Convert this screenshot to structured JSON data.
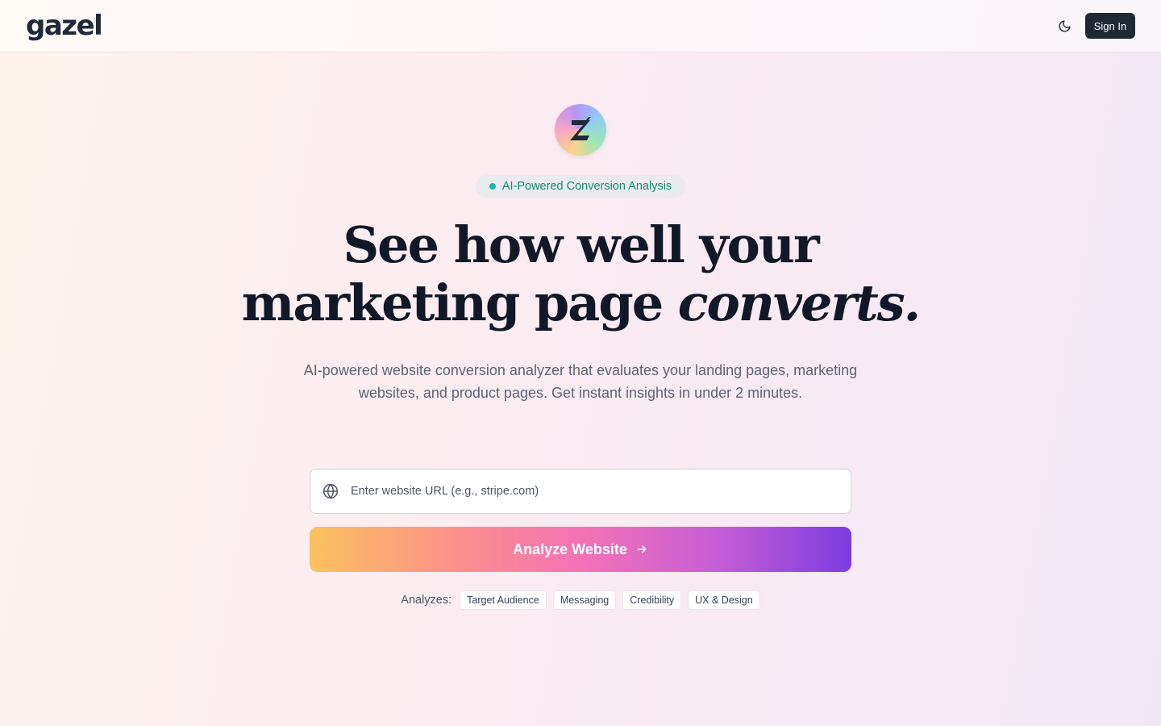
{
  "header": {
    "logo": "gazel",
    "sign_in_label": "Sign In"
  },
  "hero": {
    "badge_text": "AI-Powered Conversion Analysis",
    "headline_line1": "See how well your",
    "headline_line2_plain": "marketing page ",
    "headline_line2_italic": "converts.",
    "subtitle": "AI-powered website conversion analyzer that evaluates your landing pages, marketing websites, and product pages. Get instant insights in under 2 minutes."
  },
  "search": {
    "placeholder": "Enter website URL (e.g., stripe.com)",
    "value": ""
  },
  "analyze_button": {
    "label": "Analyze Website"
  },
  "analyzes": {
    "label": "Analyzes:",
    "tags": [
      "Target Audience",
      "Messaging",
      "Credibility",
      "UX & Design"
    ]
  },
  "icons": {
    "theme": "moon-icon",
    "url": "globe-icon",
    "arrow": "arrow-right-icon",
    "brand": "gazel-z-icon"
  },
  "colors": {
    "accent_green": "#14b8a6",
    "button_dark": "#1f2933",
    "gradient_start": "#fbc15e",
    "gradient_mid": "#f472b6",
    "gradient_end": "#7c3ce0"
  }
}
